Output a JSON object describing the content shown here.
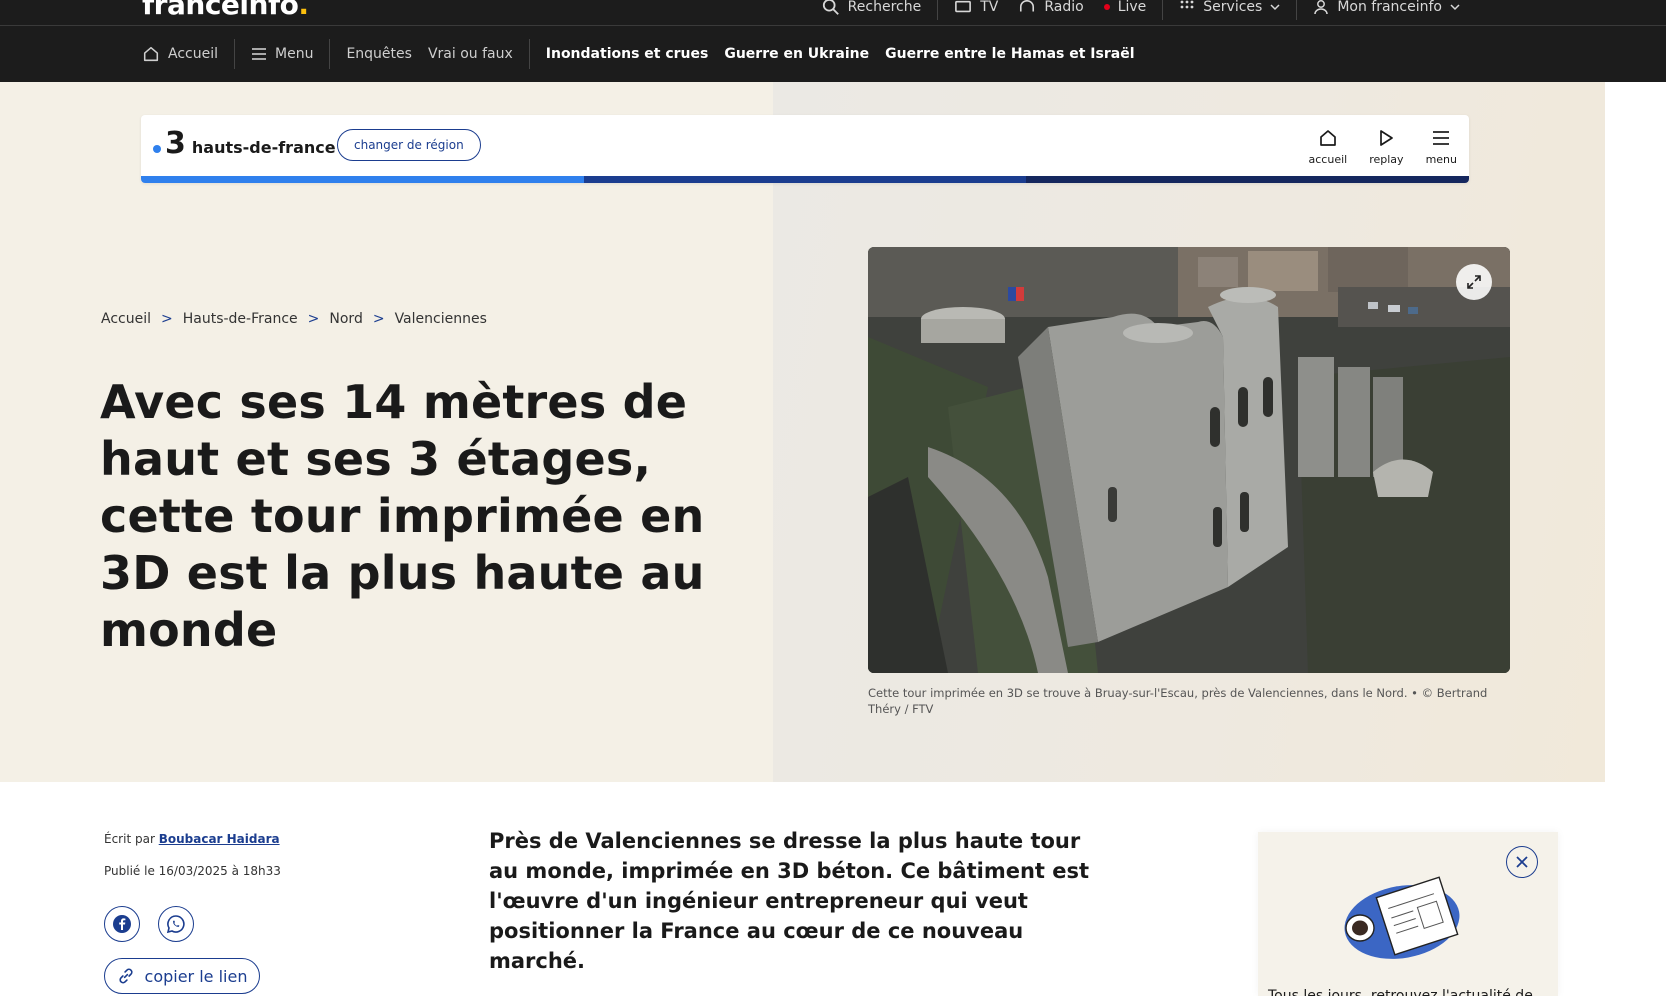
{
  "topbar": {
    "logo_text": "franceinfo",
    "logo_dot": ".",
    "search_label": "Recherche",
    "tv_label": "TV",
    "radio_label": "Radio",
    "live_label": "Live",
    "services_label": "Services",
    "account_label": "Mon franceinfo"
  },
  "navbar": {
    "home_label": "Accueil",
    "menu_label": "Menu",
    "links": [
      "Enquêtes",
      "Vrai ou faux"
    ],
    "hot_topics": [
      "Inondations et crues",
      "Guerre en Ukraine",
      "Guerre entre le Hamas et Israël"
    ]
  },
  "region": {
    "channel_number": "3",
    "region_name": "hauts-de-france",
    "change_label": "changer de région",
    "actions": [
      "accueil",
      "replay",
      "menu"
    ],
    "bar_colors": [
      "#2f80ed",
      "#1b3d8f",
      "#15275e"
    ]
  },
  "breadcrumb": [
    "Accueil",
    "Hauts-de-France",
    "Nord",
    "Valenciennes"
  ],
  "breadcrumb_separator": ">",
  "article": {
    "title": "Avec ses 14 mètres de haut et ses 3 étages, cette tour imprimée en 3D est la plus haute au monde",
    "caption": "Cette tour imprimée en 3D se trouve à Bruay-sur-l'Escau, près de Valenciennes, dans le Nord. • © Bertrand Théry / FTV",
    "byline_prefix": "Écrit par",
    "author": "Boubacar Haidara",
    "published": "Publié le 16/03/2025 à 18h33",
    "copy_link_label": "copier le lien",
    "lead": "Près de Valenciennes se dresse la plus haute tour au monde, imprimée en 3D béton. Ce bâtiment est l'œuvre d'un ingénieur entrepreneur qui veut positionner la France au cœur de ce nouveau marché."
  },
  "promo": {
    "text": "Tous les jours, retrouvez l'actualité de"
  },
  "colors": {
    "accent_blue": "#1b3d8f",
    "hero_bg": "#f4f0e6",
    "nav_bg": "#1c1c1c",
    "logo_dot": "#fcc00e"
  }
}
